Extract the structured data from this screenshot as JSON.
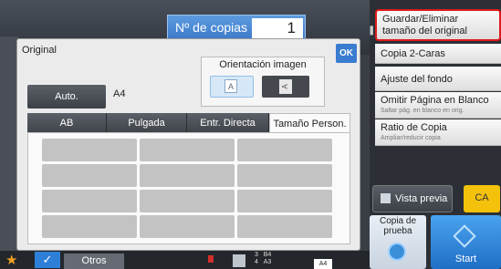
{
  "header": {
    "copies_label": "Nº de copias",
    "copies_value": "1"
  },
  "right_panel": {
    "items": [
      {
        "label": "Guardar/Eliminar tamaño del original",
        "sub": "",
        "highlighted": true
      },
      {
        "label": "Copia 2-Caras",
        "sub": ""
      },
      {
        "label": "Ajuste del fondo",
        "sub": ""
      },
      {
        "label": "Omitir Página en Blanco",
        "sub": "Saltar pág. en blanco en orig."
      },
      {
        "label": "Ratio de Copia",
        "sub": "Ampliar/reducir copia"
      }
    ],
    "preview_label": "Vista previa",
    "ca_label": "CA",
    "proof_label": "Copia de prueba",
    "start_label": "Start"
  },
  "dialog": {
    "title": "Original",
    "ok_label": "OK",
    "orientation_label": "Orientación imagen",
    "orientation_options": [
      "A",
      "A"
    ],
    "auto_label": "Auto.",
    "auto_value": "A4",
    "tabs": [
      {
        "label": "AB",
        "active": false
      },
      {
        "label": "Pulgada",
        "active": false
      },
      {
        "label": "Entr. Directa",
        "active": false
      },
      {
        "label": "Tamaño Person.",
        "active": true
      }
    ],
    "grid_rows": 4,
    "grid_cols": 3
  },
  "bottom_bar": {
    "otros_label": "Otros",
    "tray_lines": [
      "3",
      "4"
    ],
    "tray_sizes": [
      "B4",
      "A3"
    ],
    "paper_label": "A4"
  },
  "colors": {
    "accent_blue": "#3a7cd0",
    "highlight_red": "#e01a1a",
    "ca_yellow": "#f4c20d"
  }
}
